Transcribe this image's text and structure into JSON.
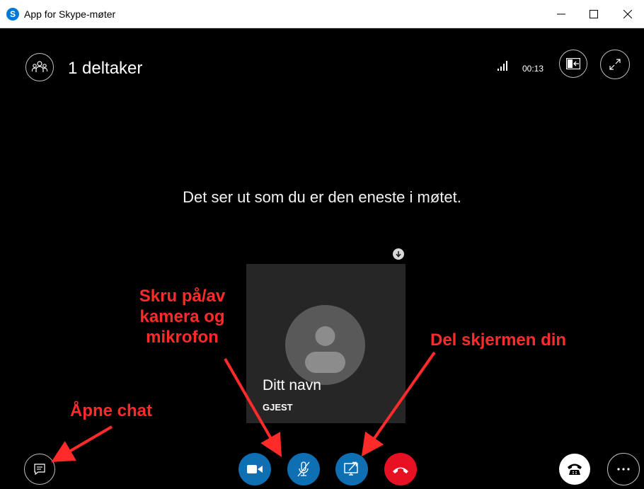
{
  "window": {
    "title": "App for Skype-møter",
    "app_icon_letter": "S",
    "controls": [
      "minimize",
      "maximize",
      "close"
    ]
  },
  "header": {
    "participants_label": "1 deltaker",
    "timer": "00:13",
    "icons": [
      "participants-icon",
      "signal-strength-icon",
      "content-panel-icon",
      "fullscreen-icon"
    ]
  },
  "main": {
    "message": "Det ser ut som du er den eneste i møtet."
  },
  "tile": {
    "name": "Ditt navn",
    "role": "GJEST"
  },
  "controls": {
    "left": [
      "chat-icon"
    ],
    "center": [
      "video-camera-icon",
      "microphone-muted-icon",
      "share-screen-icon",
      "hang-up-icon"
    ],
    "right": [
      "phone-keypad-icon",
      "more-options-icon"
    ],
    "colors": {
      "blue": "#0f6fb3",
      "red": "#e81123"
    }
  },
  "annotations": {
    "camera_mic_lines": [
      "Skru på/av",
      "kamera og",
      "mikrofon"
    ],
    "share_screen": "Del skjermen din",
    "chat": "Åpne chat",
    "color": "#ff2b2b"
  }
}
